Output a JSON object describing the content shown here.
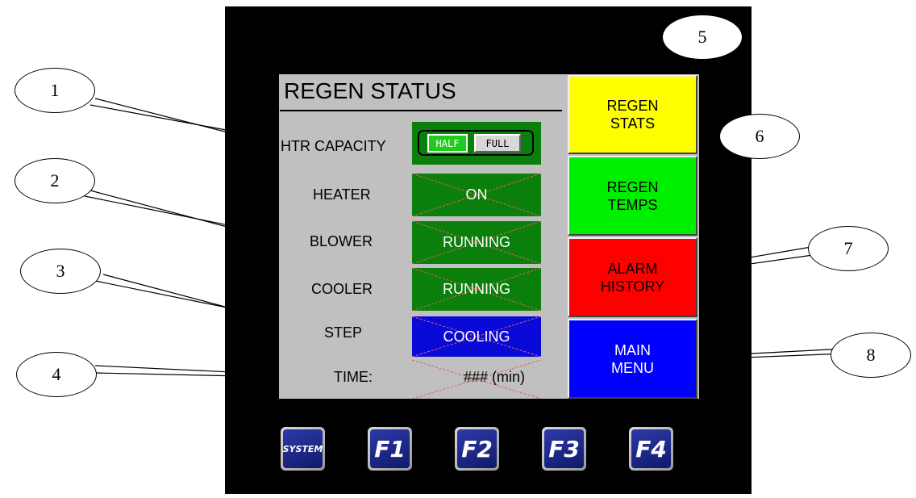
{
  "screen": {
    "title": "REGEN STATUS",
    "rows": {
      "htr_capacity": {
        "label": "HTR CAPACITY",
        "options": [
          "HALF",
          "FULL"
        ],
        "selected": "HALF"
      },
      "heater": {
        "label": "HEATER",
        "value": "ON"
      },
      "blower": {
        "label": "BLOWER",
        "value": "RUNNING"
      },
      "cooler": {
        "label": "COOLER",
        "value": "RUNNING"
      },
      "step": {
        "label": "STEP",
        "value": "COOLING"
      },
      "time": {
        "label": "TIME:",
        "value": "### (min)"
      }
    },
    "side_buttons": {
      "regen_stats": {
        "label": "REGEN\nSTATS",
        "color": "#ffff00"
      },
      "regen_temps": {
        "label": "REGEN\nTEMPS",
        "color": "#00ee00"
      },
      "alarm_history": {
        "label": "ALARM\nHISTORY",
        "color": "#ff0000"
      },
      "main_menu": {
        "label": "MAIN\nMENU",
        "color": "#0000ff"
      }
    }
  },
  "function_keys": [
    "SYSTEM",
    "F1",
    "F2",
    "F3",
    "F4"
  ],
  "callouts": [
    "1",
    "2",
    "3",
    "4",
    "5",
    "6",
    "7",
    "8"
  ]
}
